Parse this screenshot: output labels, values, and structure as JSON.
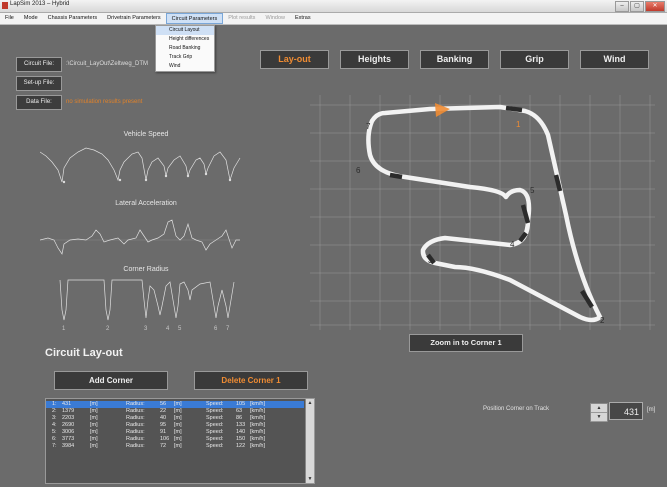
{
  "window": {
    "title": "LapSim 2013 – Hybrid",
    "min": "–",
    "max": "▢",
    "close": "✕"
  },
  "menu": [
    {
      "label": "File"
    },
    {
      "label": "Mode"
    },
    {
      "label": "Chassis Parameters"
    },
    {
      "label": "Drivetrain Parameters"
    },
    {
      "label": "Circuit Parameters"
    },
    {
      "label": "Plot results"
    },
    {
      "label": "Window"
    },
    {
      "label": "Extras"
    }
  ],
  "dropdown": [
    "Circuit Layout",
    "Height differences",
    "Road Banking",
    "Track Grip",
    "Wind"
  ],
  "files": {
    "circuit_btn": "Circuit File:",
    "circuit_path": ":\\Circuit_LayOut\\Zeltweg_DTM",
    "setup_btn": "Set-up File:",
    "data_btn": "Data File:",
    "data_status": "no simulation results present"
  },
  "tabs": [
    {
      "label": "Lay-out",
      "active": true
    },
    {
      "label": "Heights",
      "active": false
    },
    {
      "label": "Banking",
      "active": false
    },
    {
      "label": "Grip",
      "active": false
    },
    {
      "label": "Wind",
      "active": false
    }
  ],
  "charts": {
    "vehicle_speed": "Vehicle Speed",
    "lateral_accel": "Lateral Acceleration",
    "corner_radius": "Corner Radius",
    "corner_marks": [
      "1",
      "2",
      "3",
      "4",
      "5",
      "6",
      "7"
    ]
  },
  "track": {
    "corner_labels": [
      "1",
      "2",
      "3",
      "4",
      "5",
      "6",
      "7"
    ],
    "zoom_button": "Zoom in to Corner 1"
  },
  "section": {
    "title": "Circuit Lay-out",
    "add_corner": "Add Corner",
    "delete_corner": "Delete Corner 1"
  },
  "corners": [
    {
      "n": "1:",
      "pos": "431",
      "unit": "[m]",
      "rlabel": "Radius:",
      "radius": "56",
      "runit": "[m]",
      "slabel": "Speed:",
      "speed": "105",
      "sunit": "[km/h]"
    },
    {
      "n": "2:",
      "pos": "1379",
      "unit": "[m]",
      "rlabel": "Radius:",
      "radius": "22",
      "runit": "[m]",
      "slabel": "Speed:",
      "speed": "63",
      "sunit": "[km/h]"
    },
    {
      "n": "3:",
      "pos": "2203",
      "unit": "[m]",
      "rlabel": "Radius:",
      "radius": "40",
      "runit": "[m]",
      "slabel": "Speed:",
      "speed": "86",
      "sunit": "[km/h]"
    },
    {
      "n": "4:",
      "pos": "2690",
      "unit": "[m]",
      "rlabel": "Radius:",
      "radius": "95",
      "runit": "[m]",
      "slabel": "Speed:",
      "speed": "133",
      "sunit": "[km/h]"
    },
    {
      "n": "5:",
      "pos": "3006",
      "unit": "[m]",
      "rlabel": "Radius:",
      "radius": "91",
      "runit": "[m]",
      "slabel": "Speed:",
      "speed": "140",
      "sunit": "[km/h]"
    },
    {
      "n": "6:",
      "pos": "3773",
      "unit": "[m]",
      "rlabel": "Radius:",
      "radius": "106",
      "runit": "[m]",
      "slabel": "Speed:",
      "speed": "150",
      "sunit": "[km/h]"
    },
    {
      "n": "7:",
      "pos": "3984",
      "unit": "[m]",
      "rlabel": "Radius:",
      "radius": "72",
      "runit": "[m]",
      "slabel": "Speed:",
      "speed": "122",
      "sunit": "[km/h]"
    }
  ],
  "position": {
    "label": "Position Corner on Track",
    "value": "431",
    "unit": "[m]",
    "up": "▲",
    "down": "▼"
  },
  "colors": {
    "accent": "#f08c33",
    "selection": "#3a7bd5",
    "background": "#6b6b6b"
  }
}
